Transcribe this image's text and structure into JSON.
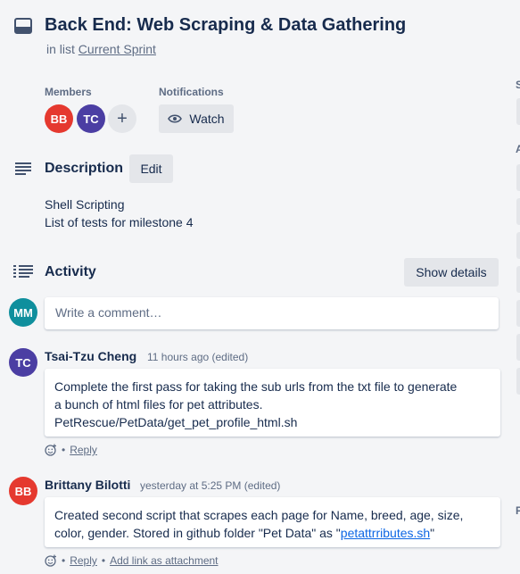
{
  "card": {
    "title": "Back End: Web Scraping & Data Gathering",
    "in_list_prefix": "in list",
    "list_name": "Current Sprint"
  },
  "members": {
    "label": "Members",
    "avatars": [
      "BB",
      "TC"
    ],
    "add_icon": "plus-icon"
  },
  "notifications": {
    "label": "Notifications",
    "watch_label": "Watch",
    "watch_icon": "eye-icon"
  },
  "description": {
    "title": "Description",
    "edit_label": "Edit",
    "lines": [
      "Shell Scripting",
      "List of tests for milestone 4"
    ]
  },
  "activity": {
    "title": "Activity",
    "show_details_label": "Show details",
    "current_user_initials": "MM",
    "comment_placeholder": "Write a comment…",
    "comments": [
      {
        "initials": "TC",
        "author": "Tsai-Tzu Cheng",
        "time": "11 hours ago (edited)",
        "lines": [
          "Complete the first pass for taking the sub urls from the txt file to generate",
          "a bunch of html files for pet attributes.",
          "PetRescue/PetData/get_pet_profile_html.sh"
        ],
        "reply_label": "Reply"
      },
      {
        "initials": "BB",
        "author": "Brittany Bilotti",
        "time": "yesterday at 5:25 PM (edited)",
        "line1": "Created second script that scrapes each page for Name, breed, age, size,",
        "line2_prefix": "color, gender. Stored in github folder \"Pet Data\" as \"",
        "line2_link": "petattrributes.sh",
        "line2_suffix": "\"",
        "reply_label": "Reply",
        "attach_label": "Add link as attachment"
      }
    ]
  },
  "sidebar_partial": {
    "labels": [
      "S",
      "A",
      "P"
    ]
  },
  "colors": {
    "bb_avatar": "#e5392f",
    "tc_avatar": "#4b3ea3",
    "mm_avatar": "#0f8f9d",
    "link": "#0c66e4"
  }
}
